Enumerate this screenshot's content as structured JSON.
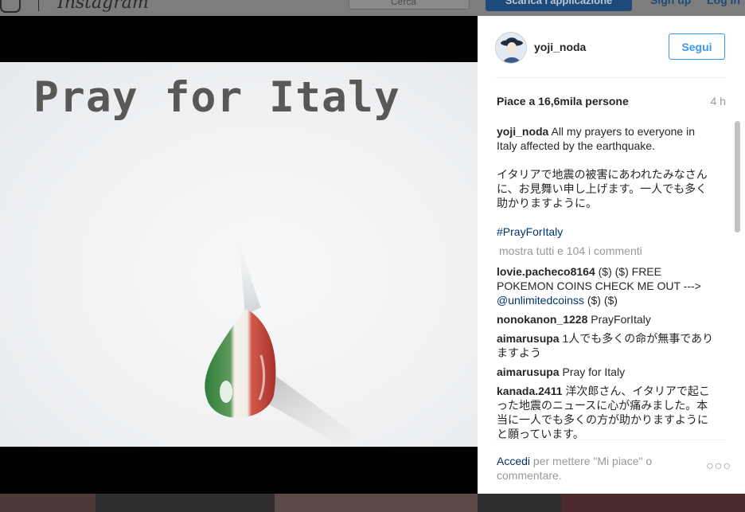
{
  "background": {
    "brand": "Instagram",
    "search_placeholder": "Cerca",
    "download_label": "Scarica l'applicazione",
    "signup_label": "Sign up",
    "login_label": "Log in"
  },
  "post": {
    "image_text": "Pray for Italy",
    "username": "yoji_noda",
    "follow_label": "Segui",
    "likes": "Piace a 16,6mila persone",
    "time": "4 h",
    "caption": {
      "user": "yoji_noda",
      "text": "All my prayers to everyone in Italy affected by the earthquake.",
      "japanese": "イタリアで地震の被害にあわれたみなさんに、お見舞い申し上げます。一人でも多く助かりますように。",
      "hashtag": "#PrayForItaly"
    },
    "view_all": "mostra tutti e 104 i commenti",
    "comments": [
      {
        "user": "lovie.pacheco8164",
        "text": "($) ($) FREE POKEMON COINS CHECK ME OUT --->",
        "mention": "@unlimitedcoinss",
        "after": "($) ($)"
      },
      {
        "user": "nonokanon_1228",
        "text": "PrayForItaly"
      },
      {
        "user": "aimarusupa",
        "text": "1人でも多くの命が無事でありますよう"
      },
      {
        "user": "aimarusupa",
        "text": "Pray for Italy"
      },
      {
        "user": "kanada.2411",
        "text": "洋次郎さん、イタリアで起こった地震のニュースに心が痛みました。本当に一人でも多くの方が助かりますようにと願っています。"
      }
    ],
    "login_link": "Accedi",
    "login_text": "per mettere \"Mi piace\" o commentare.",
    "more_glyph": "○○○"
  },
  "colors": {
    "link": "#003569",
    "accent": "#3897f0",
    "muted": "#999999"
  },
  "icons": [
    "instagram-camera-icon",
    "ellipsis-icon"
  ]
}
